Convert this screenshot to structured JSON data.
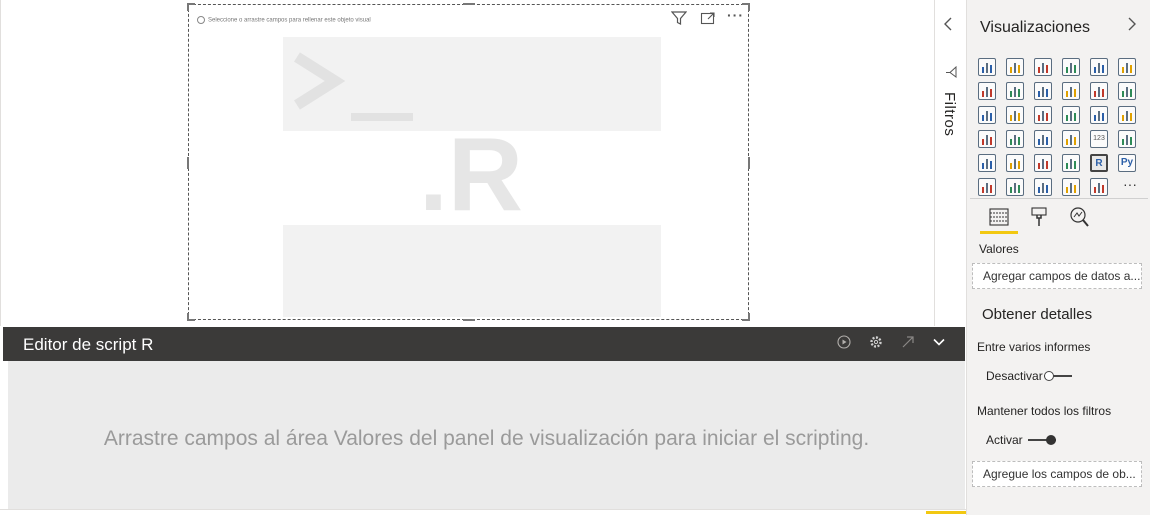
{
  "visual": {
    "hint": "Seleccione o arrastre campos para rellenar este objeto visual",
    "logo_text": ".R",
    "header_icons": [
      "filter-icon",
      "focus-mode-icon",
      "more-options-icon"
    ]
  },
  "script_editor": {
    "title": "Editor de script R",
    "message": "Arrastre campos al área Valores del panel de visualización para iniciar el scripting.",
    "icons": [
      "run-script-icon",
      "settings-icon",
      "expand-icon",
      "collapse-icon"
    ]
  },
  "filters_pane": {
    "label": "Filtros"
  },
  "visualizations_pane": {
    "title": "Visualizaciones",
    "selected_visual": "r-script-visual",
    "visual_icons": [
      "stacked-bar-icon",
      "stacked-column-icon",
      "clustered-bar-icon",
      "clustered-column-icon",
      "100-stacked-bar-icon",
      "100-stacked-column-icon",
      "line-chart-icon",
      "area-chart-icon",
      "stacked-area-icon",
      "line-and-column-icon",
      "line-clustered-column-icon",
      "ribbon-chart-icon",
      "waterfall-icon",
      "funnel-icon",
      "scatter-icon",
      "pie-chart-icon",
      "donut-chart-icon",
      "treemap-icon",
      "map-icon",
      "filled-map-icon",
      "shape-map-icon",
      "gauge-icon",
      "card-icon",
      "multi-row-card-icon",
      "kpi-icon",
      "slicer-icon",
      "table-icon",
      "matrix-icon",
      "r-visual-icon",
      "python-visual-icon",
      "key-influencers-icon",
      "decomposition-tree-icon",
      "qa-icon",
      "smart-narrative-icon",
      "power-apps-icon"
    ],
    "visual_icon_texts": {
      "r-visual-icon": "R",
      "python-visual-icon": "Py",
      "card-icon": "123"
    },
    "tools": [
      "fields-icon",
      "format-icon",
      "analytics-icon"
    ],
    "values_label": "Valores",
    "values_placeholder": "Agregar campos de datos a...",
    "details_title": "Obtener detalles",
    "cross_report_label": "Entre varios informes",
    "cross_report_toggle": "Desactivar",
    "cross_report_on": false,
    "keep_filters_label": "Mantener todos los filtros",
    "keep_filters_toggle": "Activar",
    "keep_filters_on": true,
    "drillthrough_placeholder": "Agregue los campos de ob..."
  },
  "colors": {
    "accent": "#f2c811",
    "editor_bar": "#3b3a39",
    "pane_bg": "#f3f2f1"
  }
}
